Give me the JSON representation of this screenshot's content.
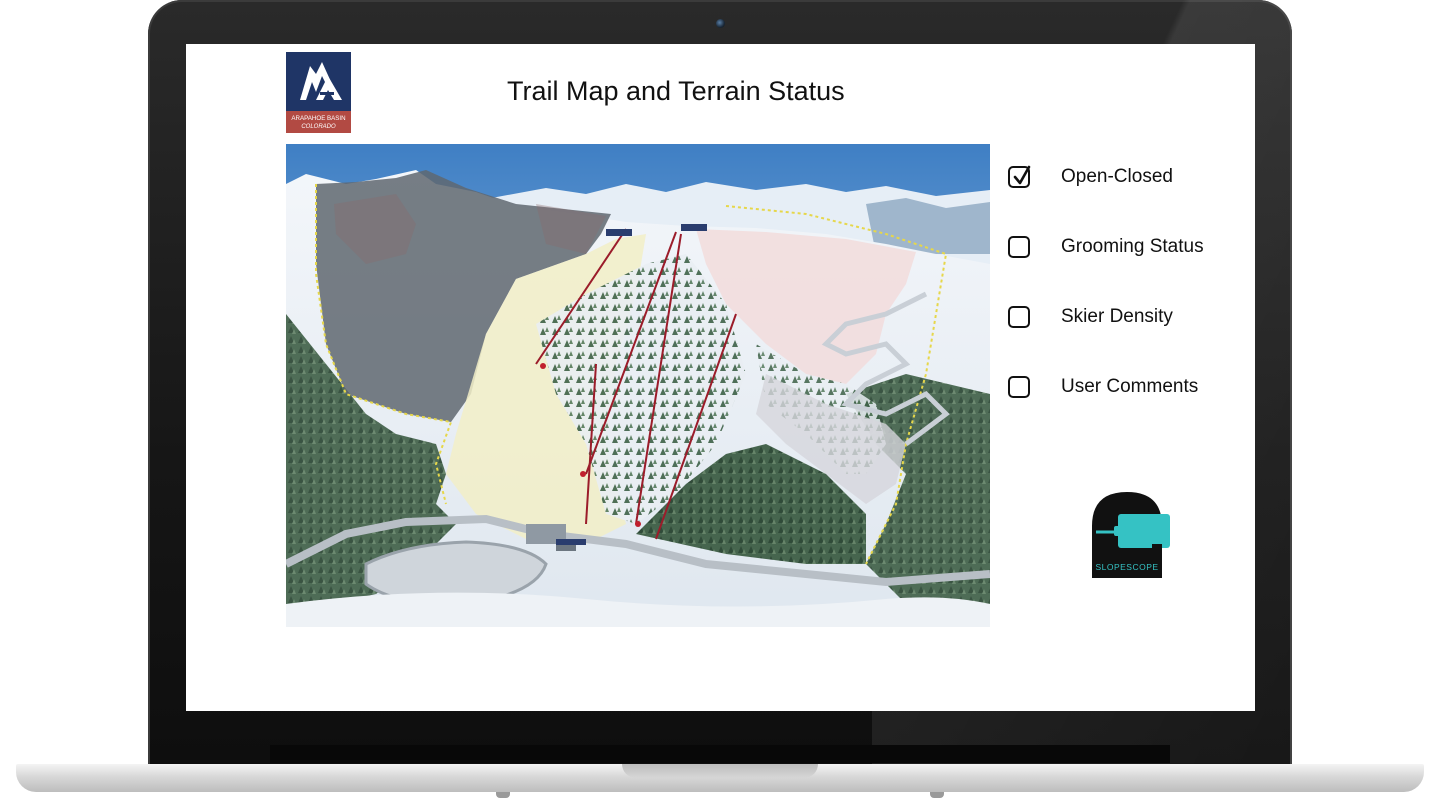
{
  "page": {
    "title": "Trail Map and Terrain Status"
  },
  "brand": {
    "arapahoe_logo_text_line1": "ARAPAHOE BASIN",
    "arapahoe_logo_text_line2": "COLORADO",
    "arapahoe_color": "#1f3566",
    "arapahoe_band_color": "#b24a43",
    "slopescope_text": "SLOPESCOPE",
    "slopescope_accent": "#35c2c4"
  },
  "layers": [
    {
      "label": "Open-Closed",
      "checked": true
    },
    {
      "label": "Grooming Status",
      "checked": false
    },
    {
      "label": "Skier Density",
      "checked": false
    },
    {
      "label": "User Comments",
      "checked": false
    }
  ],
  "icons": {
    "laptop_camera": "camera-icon",
    "checkbox_checked": "checkmark-icon"
  }
}
